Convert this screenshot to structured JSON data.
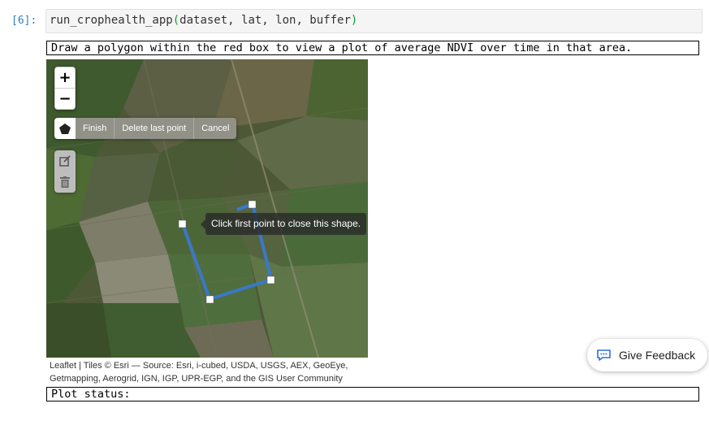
{
  "cell": {
    "prompt": "[6]:",
    "code_func": "run_crophealth_app",
    "code_paren_open": "(",
    "code_args": "dataset, lat, lon, buffer",
    "code_paren_close": ")"
  },
  "output": {
    "instruction": "Draw a polygon within the red box to view a plot of average NDVI over time in that area.",
    "plot_status": "Plot status:"
  },
  "map": {
    "zoom_in": "+",
    "zoom_out": "−",
    "draw_actions": {
      "finish": "Finish",
      "delete_last": "Delete last point",
      "cancel": "Cancel"
    },
    "tooltip": "Click first point to close this shape.",
    "attribution_line1": "Leaflet | Tiles © Esri — Source: Esri, i-cubed, USDA, USGS, AEX, GeoEye,",
    "attribution_line2": "Getmapping, Aerogrid, IGN, IGP, UPR-EGP, and the GIS User Community",
    "polygon_color": "#3a78c9",
    "icons": [
      "polygon-icon",
      "edit-icon",
      "trash-icon"
    ]
  },
  "feedback": {
    "label": "Give Feedback",
    "icon": "chat-bubble-icon",
    "icon_color": "#2f6fd6"
  }
}
